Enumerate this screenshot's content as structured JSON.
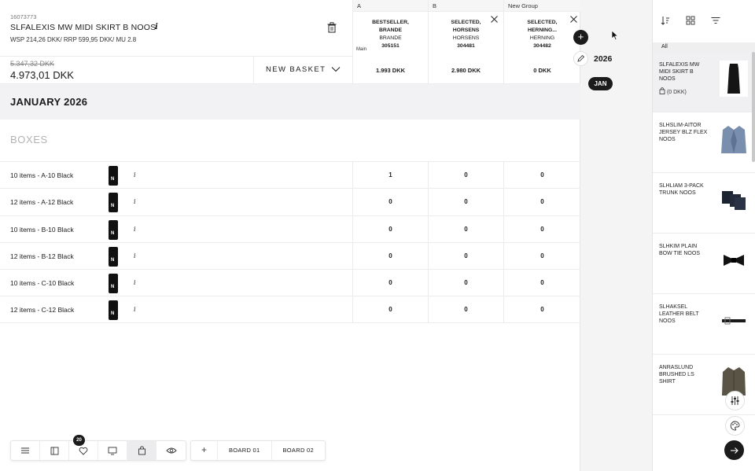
{
  "product": {
    "id": "16073773",
    "name": "SLFALEXIS MW MIDI SKIRT B NOOS",
    "price_line": "WSP 214,26 DKK/ RRP 599,95 DKK/ MU 2.8",
    "info_icon": "info-icon",
    "delete_icon": "trash-icon"
  },
  "columns": [
    {
      "letter": "A",
      "line1": "BESTSELLER,",
      "line2": "BRANDE",
      "city": "BRANDE",
      "code": "305151",
      "tag": "Main",
      "total": "1.993 DKK"
    },
    {
      "letter": "B",
      "line1": "SELECTED,",
      "line2": "HORSENS",
      "city": "HORSENS",
      "code": "304481",
      "tag": "",
      "total": "2.980 DKK"
    },
    {
      "letter": "New Group",
      "line1": "SELECTED,",
      "line2": "HERNING...",
      "city": "HERNING",
      "code": "304482",
      "tag": "",
      "total": "0 DKK"
    }
  ],
  "totals": {
    "old_price": "5.347,32 DKK",
    "new_price": "4.973,01 DKK",
    "basket_label": "NEW BASKET"
  },
  "month_title": "JANUARY 2026",
  "boxes_title": "BOXES",
  "rows": [
    {
      "label": "10 items - A-10 Black",
      "values": [
        "1",
        "0",
        "0"
      ]
    },
    {
      "label": "12 items - A-12 Black",
      "values": [
        "0",
        "0",
        "0"
      ]
    },
    {
      "label": "10 items - B-10 Black",
      "values": [
        "0",
        "0",
        "0"
      ]
    },
    {
      "label": "12 items - B-12 Black",
      "values": [
        "0",
        "0",
        "0"
      ]
    },
    {
      "label": "10 items - C-10 Black",
      "values": [
        "0",
        "0",
        "0"
      ]
    },
    {
      "label": "12 items - C-12 Black",
      "values": [
        "0",
        "0",
        "0"
      ]
    }
  ],
  "thumb_letter": "N",
  "row_info": "i",
  "timeline": {
    "add": "+",
    "year": "2026",
    "month": "JAN"
  },
  "side": {
    "tab_all": "All",
    "items": [
      {
        "name": "SLFALEXIS MW MIDI SKIRT B NOOS",
        "stock": "(0 DKK)",
        "image": "skirt"
      },
      {
        "name": "SLHSLIM-AITOR JERSEY BLZ FLEX NOOS",
        "stock": "",
        "image": "blazer"
      },
      {
        "name": "SLHLIAM 3-PACK TRUNK NOOS",
        "stock": "",
        "image": "trunks"
      },
      {
        "name": "SLHKIM PLAIN BOW TIE NOOS",
        "stock": "",
        "image": "bowtie"
      },
      {
        "name": "SLHAKSEL LEATHER BELT NOOS",
        "stock": "",
        "image": "belt"
      },
      {
        "name": "ANRASLUND BRUSHED LS SHIRT",
        "stock": "",
        "image": "shirt"
      }
    ]
  },
  "toolbar": {
    "badge": "20",
    "boards": [
      "BOARD 01",
      "BOARD 02"
    ],
    "add": "+"
  },
  "colors": {
    "accent": "#1b1b1b",
    "band": "#f2f2f4",
    "muted": "#b3b3b3"
  }
}
